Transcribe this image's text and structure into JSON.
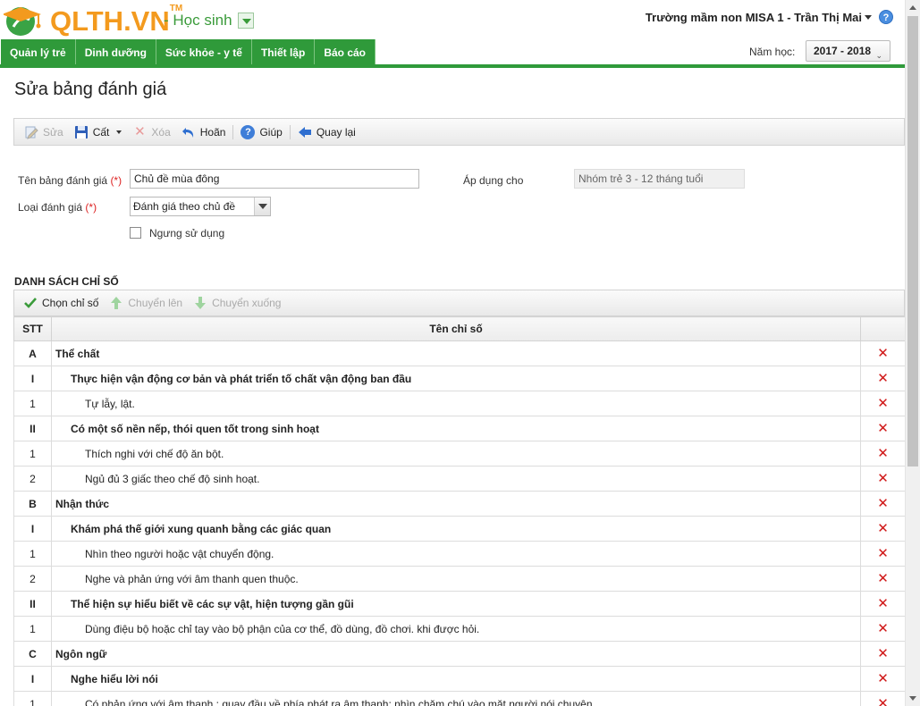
{
  "header": {
    "logo_text": "QLTH.VN",
    "logo_tm": "TM",
    "role": "- Học sinh",
    "user": "Trường mầm non MISA 1 - Trần Thị Mai"
  },
  "nav": {
    "tabs": [
      "Quản lý trẻ",
      "Dinh dưỡng",
      "Sức khỏe - y tế",
      "Thiết lập",
      "Báo cáo"
    ],
    "year_label": "Năm học:",
    "year_value": "2017 - 2018"
  },
  "page": {
    "title": "Sửa bảng đánh giá"
  },
  "toolbar": {
    "edit": "Sửa",
    "save": "Cất",
    "delete": "Xóa",
    "undo": "Hoãn",
    "help": "Giúp",
    "back": "Quay lại"
  },
  "form": {
    "name_label": "Tên bảng đánh giá",
    "name_value": "Chủ đề mùa đông",
    "type_label": "Loại đánh giá",
    "type_value": "Đánh giá theo chủ đề",
    "required_mark": "(*)",
    "apply_label": "Áp dụng cho",
    "apply_value": "Nhóm trẻ 3 - 12 tháng tuổi",
    "inactive_label": "Ngưng sử dụng",
    "inactive_checked": false
  },
  "list": {
    "title": "DANH SÁCH CHỈ SỐ",
    "choose": "Chọn chỉ số",
    "move_up": "Chuyển lên",
    "move_down": "Chuyển xuống",
    "col_stt": "STT",
    "col_name": "Tên chỉ số",
    "delete_glyph": "✕",
    "rows": [
      {
        "stt": "A",
        "name": "Thể chất",
        "level": 0
      },
      {
        "stt": "I",
        "name": "Thực hiện vận động cơ bản và phát triển tố chất vận động ban đầu",
        "level": 1
      },
      {
        "stt": "1",
        "name": "Tự lẫy, lật.",
        "level": 2
      },
      {
        "stt": "II",
        "name": "Có một số nền nếp, thói quen tốt trong sinh hoạt",
        "level": 1
      },
      {
        "stt": "1",
        "name": "Thích nghi với chế độ ăn bột.",
        "level": 2
      },
      {
        "stt": "2",
        "name": "Ngủ đủ 3 giấc theo chế độ sinh hoạt.",
        "level": 2
      },
      {
        "stt": "B",
        "name": "Nhận thức",
        "level": 0
      },
      {
        "stt": "I",
        "name": "Khám phá thế giới xung quanh bằng các giác quan",
        "level": 1
      },
      {
        "stt": "1",
        "name": "Nhìn theo người hoặc vật chuyển động.",
        "level": 2
      },
      {
        "stt": "2",
        "name": "Nghe và phản ứng với âm thanh quen thuộc.",
        "level": 2
      },
      {
        "stt": "II",
        "name": "Thể hiện sự hiểu biết về các sự vật, hiện tượng gần gũi",
        "level": 1
      },
      {
        "stt": "1",
        "name": "Dùng điệu bộ hoặc chỉ tay vào bộ phận của cơ thể, đồ dùng, đồ chơi. khi được hỏi.",
        "level": 2
      },
      {
        "stt": "C",
        "name": "Ngôn ngữ",
        "level": 0
      },
      {
        "stt": "I",
        "name": "Nghe hiểu lời nói",
        "level": 1
      },
      {
        "stt": "1",
        "name": "Có phản ứng với âm thanh : quay đầu về phía phát ra âm thanh; nhìn chăm chú vào mặt người nói chuyện.",
        "level": 2
      }
    ]
  },
  "colors": {
    "brand_green": "#2f9a3a",
    "logo_orange": "#f39a1e",
    "delete_red": "#d01818"
  }
}
